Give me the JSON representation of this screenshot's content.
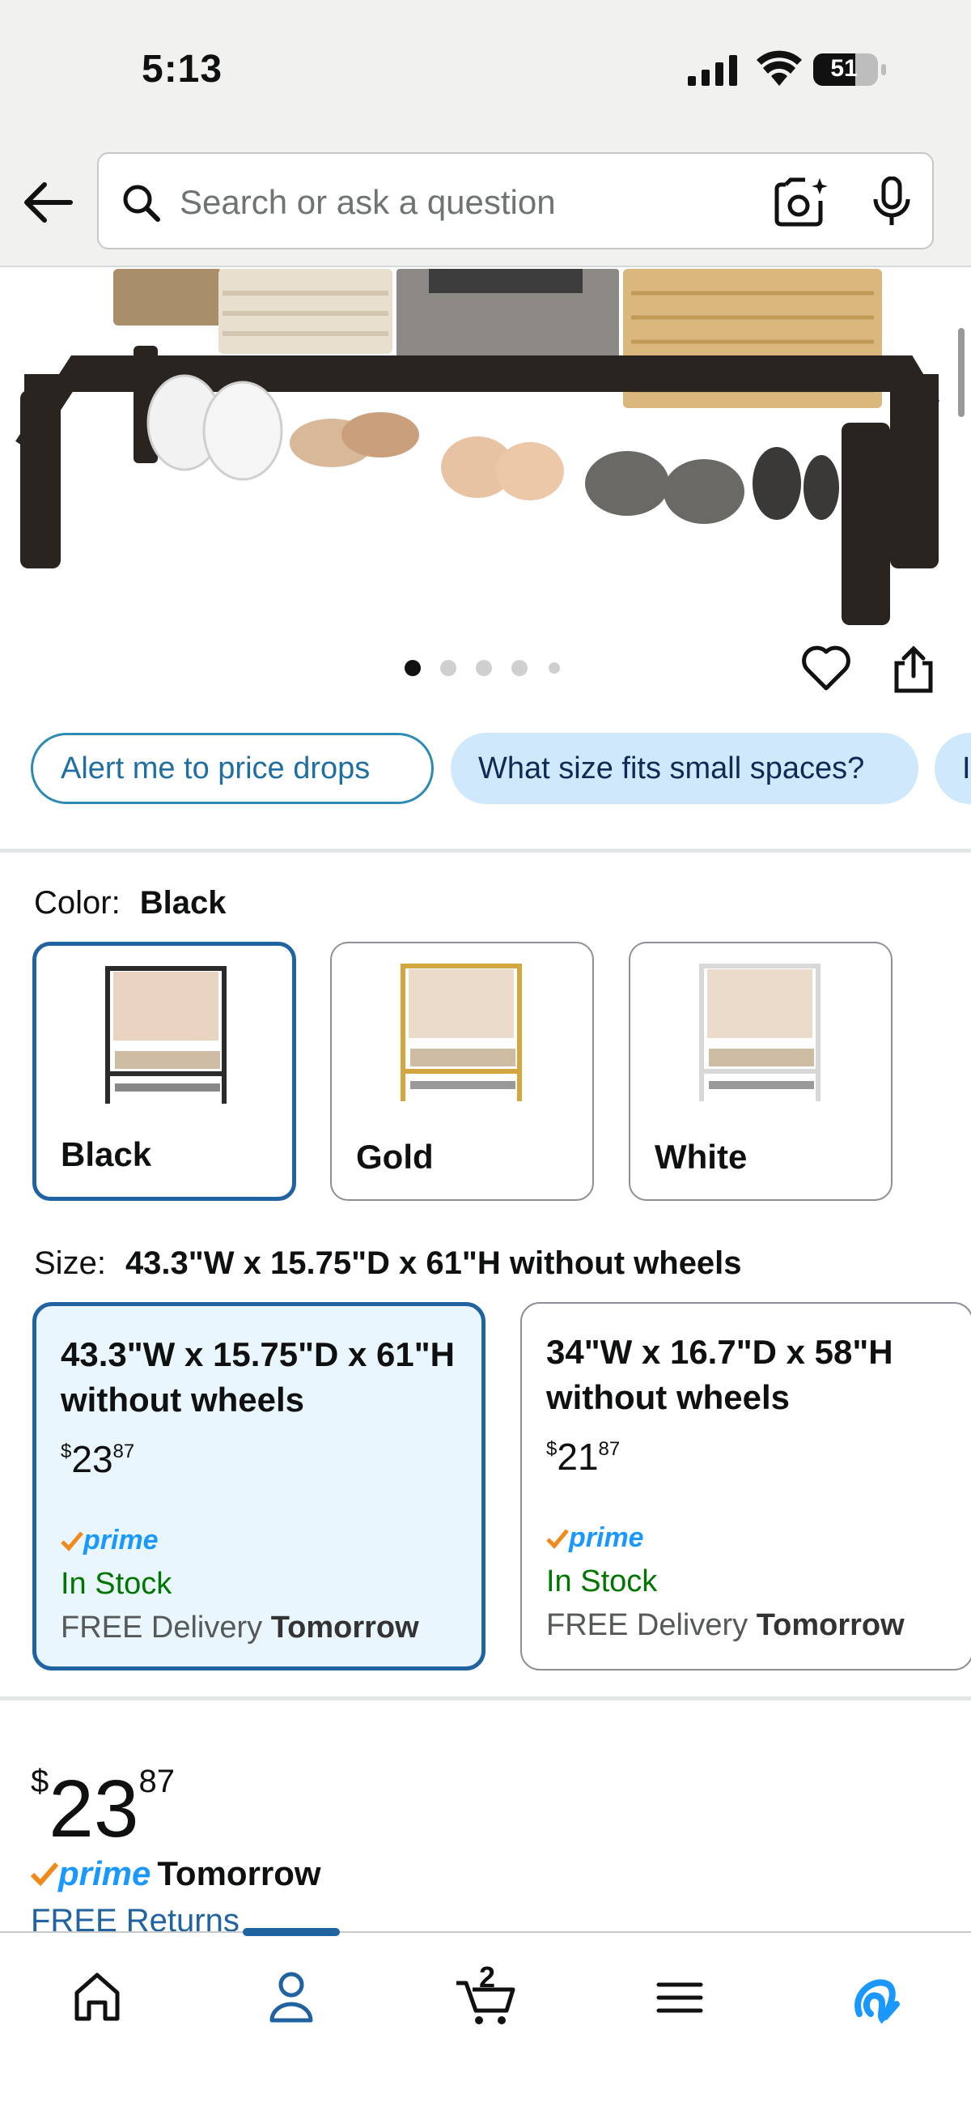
{
  "status": {
    "time": "5:13",
    "battery": "51"
  },
  "search": {
    "placeholder": "Search or ask a question"
  },
  "carousel": {
    "dots": 5,
    "active": 0
  },
  "chips": [
    "Alert me to price drops",
    "What size fits small spaces?",
    "I"
  ],
  "color": {
    "label": "Color:",
    "selected": "Black",
    "options": [
      "Black",
      "Gold",
      "White"
    ],
    "frame_colors": [
      "#2b2b2b",
      "#d4a640",
      "#f2f2f2"
    ]
  },
  "size": {
    "label": "Size:",
    "selected": "43.3\"W x 15.75\"D x 61\"H without wheels",
    "options": [
      {
        "title": "43.3\"W x 15.75\"D x 61\"H without wheels",
        "currency": "$",
        "whole": "23",
        "cents": "87",
        "prime": "prime",
        "stock": "In Stock",
        "delivery": "FREE Delivery",
        "delivery_day": "Tomorrow"
      },
      {
        "title": "34\"W x 16.7\"D x 58\"H without wheels",
        "currency": "$",
        "whole": "21",
        "cents": "87",
        "prime": "prime",
        "stock": "In Stock",
        "delivery": "FREE Delivery",
        "delivery_day": "Tomorrow"
      }
    ]
  },
  "price": {
    "currency": "$",
    "whole": "23",
    "cents": "87"
  },
  "shipping": {
    "prime": "prime",
    "when": "Tomorrow",
    "returns": "FREE Returns"
  },
  "tabs": {
    "cart_count": "2",
    "active": "account"
  },
  "colors": {
    "accent": "#2162a1",
    "prime": "#1a98ff",
    "instock": "#007600",
    "chip": "#cfe8fb"
  }
}
